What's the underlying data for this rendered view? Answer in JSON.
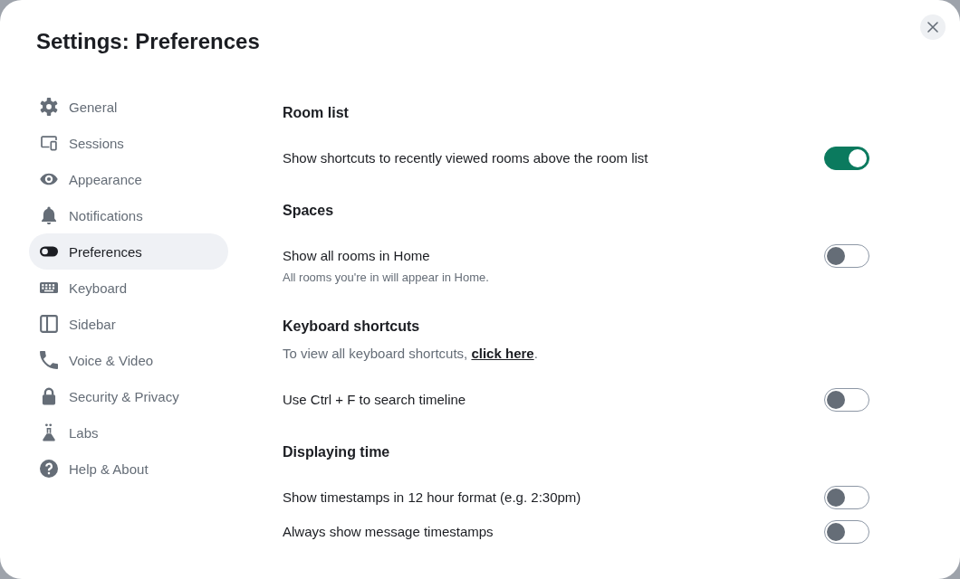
{
  "dialog": {
    "title": "Settings: Preferences"
  },
  "sidebar": {
    "items": [
      {
        "label": "General",
        "selected": false
      },
      {
        "label": "Sessions",
        "selected": false
      },
      {
        "label": "Appearance",
        "selected": false
      },
      {
        "label": "Notifications",
        "selected": false
      },
      {
        "label": "Preferences",
        "selected": true
      },
      {
        "label": "Keyboard",
        "selected": false
      },
      {
        "label": "Sidebar",
        "selected": false
      },
      {
        "label": "Voice & Video",
        "selected": false
      },
      {
        "label": "Security & Privacy",
        "selected": false
      },
      {
        "label": "Labs",
        "selected": false
      },
      {
        "label": "Help & About",
        "selected": false
      }
    ]
  },
  "sections": [
    {
      "heading": "Room list",
      "items": [
        {
          "kind": "toggle",
          "label": "Show shortcuts to recently viewed rooms above the room list",
          "on": true
        }
      ]
    },
    {
      "heading": "Spaces",
      "items": [
        {
          "kind": "toggle",
          "label": "Show all rooms in Home",
          "description": "All rooms you're in will appear in Home.",
          "on": false
        }
      ]
    },
    {
      "heading": "Keyboard shortcuts",
      "items": [
        {
          "kind": "note",
          "text": "To view all keyboard shortcuts,",
          "link": "click here",
          "after": "."
        },
        {
          "kind": "toggle",
          "label": "Use Ctrl + F to search timeline",
          "on": false
        }
      ]
    },
    {
      "heading": "Displaying time",
      "items": [
        {
          "kind": "toggle",
          "label": "Show timestamps in 12 hour format (e.g. 2:30pm)",
          "on": false
        },
        {
          "kind": "toggle",
          "label": "Always show message timestamps",
          "on": false
        }
      ]
    }
  ]
}
